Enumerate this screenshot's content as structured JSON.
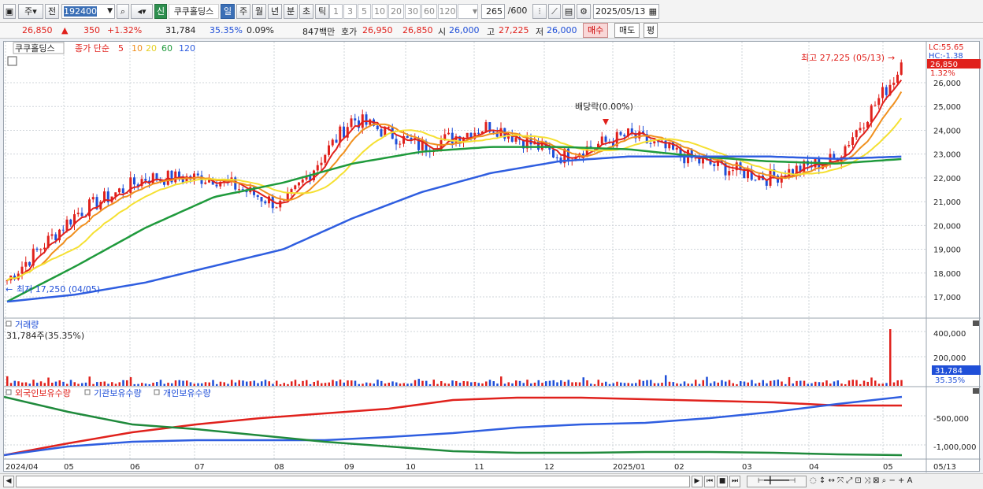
{
  "toolbar": {
    "type_btn": "주",
    "prev_btn": "전",
    "code": "192400",
    "new_badge": "신",
    "stock_name": "쿠쿠홀딩스",
    "periods": [
      "일",
      "주",
      "월",
      "년",
      "분",
      "초",
      "틱"
    ],
    "nums": [
      "1",
      "3",
      "5",
      "10",
      "20",
      "30",
      "60",
      "120"
    ],
    "count": "265",
    "count_total": "/600",
    "date": "2025/05/13"
  },
  "quote": {
    "price": "26,850",
    "arrow": "▲",
    "change": "350",
    "change_pct": "+1.32%",
    "volume": "31,784",
    "turnover": "35.35%",
    "ratio": "0.09%",
    "amount": "847백만",
    "ask_label": "호가",
    "ask1": "26,950",
    "ask2": "26,850",
    "open_label": "시",
    "open": "26,000",
    "high_label": "고",
    "high": "27,225",
    "low_label": "저",
    "low": "26,000",
    "buy": "매수",
    "sell": "매도",
    "eval": "평"
  },
  "legend": {
    "name": "쿠쿠홀딩스",
    "price_label": "종가 단순",
    "ma": [
      "5",
      "10",
      "20",
      "60",
      "120"
    ]
  },
  "annotations": {
    "high": "최고 27,225 (05/13)",
    "low": "최저 17,250 (04/05)",
    "dividend": "배당락(0.00%)"
  },
  "right_labels": {
    "lc": "LC:55.65",
    "hc": "HC:-1.38",
    "last": "26,850",
    "pct": "1.32%",
    "vol_last": "31,784",
    "vol_pct": "35.35%"
  },
  "price_axis": [
    "26,000",
    "25,000",
    "24,000",
    "23,000",
    "22,000",
    "21,000",
    "20,000",
    "19,000",
    "18,000",
    "17,000"
  ],
  "volume": {
    "title": "거래량",
    "value": "31,784주(35.35%)",
    "axis": [
      "400,000",
      "200,000"
    ]
  },
  "holdings": {
    "legend": [
      "외국인보유수량",
      "기관보유수량",
      "개인보유수량"
    ],
    "axis": [
      "-500,000",
      "-1,000,000"
    ]
  },
  "x_labels": [
    "2024/04",
    "05",
    "06",
    "07",
    "08",
    "09",
    "10",
    "11",
    "12",
    "2025/01",
    "02",
    "03",
    "04",
    "05",
    "05/13"
  ],
  "colors": {
    "up": "#e0211c",
    "down": "#1f4fd8",
    "ma5": "#e0211c",
    "ma10": "#f0901e",
    "ma20": "#f5e032",
    "ma60": "#1f9a3c",
    "ma120": "#2f5ee0"
  },
  "chart_data": {
    "type": "line",
    "title": "쿠쿠홀딩스",
    "x": [
      "2024/04",
      "05",
      "06",
      "07",
      "08",
      "09",
      "10",
      "11",
      "12",
      "2025/01",
      "02",
      "03",
      "04",
      "05"
    ],
    "series": [
      {
        "name": "종가",
        "values": [
          17700,
          20500,
          22000,
          22000,
          20800,
          24500,
          23300,
          24200,
          22900,
          23800,
          22700,
          22000,
          22800,
          26850
        ]
      },
      {
        "name": "60",
        "values": [
          16800,
          18300,
          19900,
          21200,
          21800,
          22600,
          23100,
          23300,
          23300,
          23200,
          22900,
          22700,
          22600,
          22800
        ]
      },
      {
        "name": "120",
        "values": [
          16800,
          17100,
          17600,
          18300,
          19000,
          20300,
          21400,
          22200,
          22700,
          22900,
          22900,
          22900,
          22800,
          22900
        ]
      }
    ],
    "ylim": [
      16500,
      27500
    ]
  }
}
